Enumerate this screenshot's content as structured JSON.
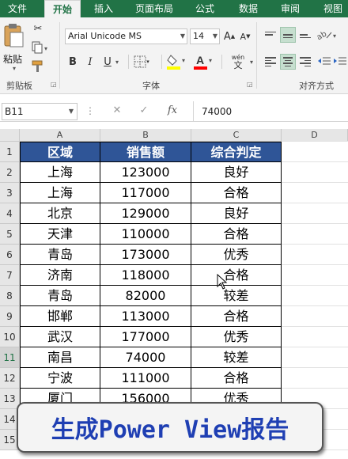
{
  "tabs": [
    "文件",
    "开始",
    "插入",
    "页面布局",
    "公式",
    "数据",
    "审阅",
    "视图"
  ],
  "ribbon": {
    "clipboard": {
      "paste_label": "粘贴",
      "group_label": "剪贴板"
    },
    "font": {
      "font_name": "Arial Unicode MS",
      "font_size": "14",
      "grow_label": "A",
      "shrink_label": "A",
      "bold": "B",
      "italic": "I",
      "underline": "U",
      "wen_label": "wén\n文",
      "group_label": "字体"
    },
    "alignment": {
      "group_label": "对齐方式"
    }
  },
  "formula_bar": {
    "name_box": "B11",
    "cancel": "✕",
    "confirm": "✓",
    "fx": "fx",
    "value": "74000"
  },
  "columns": [
    "A",
    "B",
    "C",
    "D"
  ],
  "rows": [
    "1",
    "2",
    "3",
    "4",
    "5",
    "6",
    "7",
    "8",
    "9",
    "10",
    "11",
    "12",
    "13",
    "14",
    "15"
  ],
  "table": {
    "headers": [
      "区域",
      "销售额",
      "综合判定"
    ],
    "data": [
      [
        "上海",
        "123000",
        "良好"
      ],
      [
        "上海",
        "117000",
        "合格"
      ],
      [
        "北京",
        "129000",
        "良好"
      ],
      [
        "天津",
        "110000",
        "合格"
      ],
      [
        "青岛",
        "173000",
        "优秀"
      ],
      [
        "济南",
        "118000",
        "合格"
      ],
      [
        "青岛",
        "82000",
        "较差"
      ],
      [
        "邯郸",
        "113000",
        "合格"
      ],
      [
        "武汉",
        "177000",
        "优秀"
      ],
      [
        "南昌",
        "74000",
        "较差"
      ],
      [
        "宁波",
        "111000",
        "合格"
      ],
      [
        "厦门",
        "156000",
        "优秀"
      ]
    ]
  },
  "caption": "生成Power View报告",
  "colors": {
    "excel_green": "#217346",
    "header_fill": "#2f5597",
    "caption_text": "#1f3fb3"
  }
}
